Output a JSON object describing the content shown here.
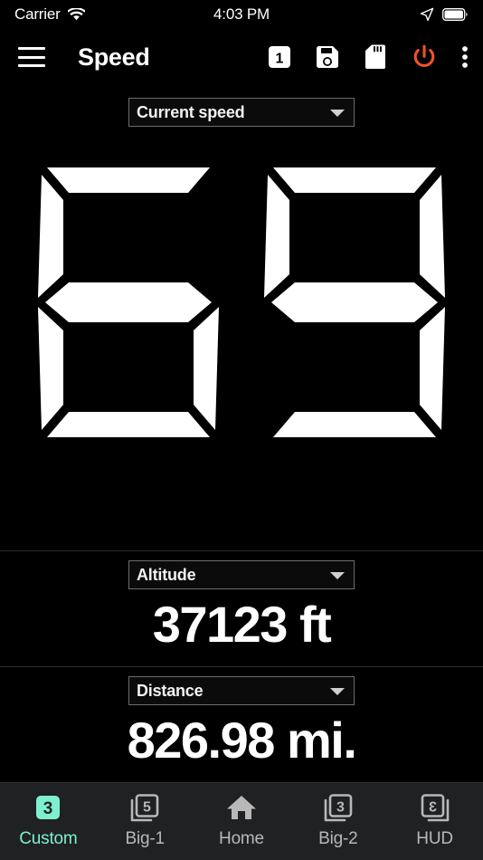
{
  "status_bar": {
    "carrier": "Carrier",
    "wifi_icon": "wifi-icon",
    "time": "4:03 PM",
    "location_icon": "location-arrow-icon",
    "battery_icon": "battery-full-icon"
  },
  "toolbar": {
    "menu_icon": "hamburger-menu-icon",
    "title": "Speed",
    "actions": [
      {
        "name": "profile-slot-button",
        "icon": "number-box-1-icon",
        "label": "1"
      },
      {
        "name": "save-button",
        "icon": "floppy-disk-icon",
        "label": ""
      },
      {
        "name": "sd-card-button",
        "icon": "sd-card-icon",
        "label": ""
      },
      {
        "name": "power-button",
        "icon": "power-icon",
        "label": "",
        "color": "#f0522a"
      },
      {
        "name": "overflow-menu-button",
        "icon": "more-vertical-icon",
        "label": ""
      }
    ]
  },
  "speed_panel": {
    "selector": {
      "label": "Current speed",
      "caret_icon": "chevron-down-icon"
    },
    "digits": [
      "6",
      "9"
    ],
    "value": "69"
  },
  "readouts": [
    {
      "selector": {
        "label": "Altitude",
        "caret_icon": "chevron-down-icon"
      },
      "value": "37123 ft",
      "number": "37123",
      "unit": "ft"
    },
    {
      "selector": {
        "label": "Distance",
        "caret_icon": "chevron-down-icon"
      },
      "value": "826.98 mi.",
      "number": "826.98",
      "unit": "mi."
    }
  ],
  "tabbar": {
    "active_color": "#7df0d0",
    "inactive_color": "#b8b8b8",
    "items": [
      {
        "label": "Custom",
        "icon": "layers-number-3-filled-icon",
        "badge": "3",
        "active": true
      },
      {
        "label": "Big-1",
        "icon": "layers-number-5-icon",
        "badge": "5",
        "active": false
      },
      {
        "label": "Home",
        "icon": "home-icon",
        "badge": "",
        "active": false
      },
      {
        "label": "Big-2",
        "icon": "layers-number-3-icon",
        "badge": "3",
        "active": false
      },
      {
        "label": "HUD",
        "icon": "layers-number-3-mirrored-icon",
        "badge": "Ɛ",
        "active": false
      }
    ]
  }
}
